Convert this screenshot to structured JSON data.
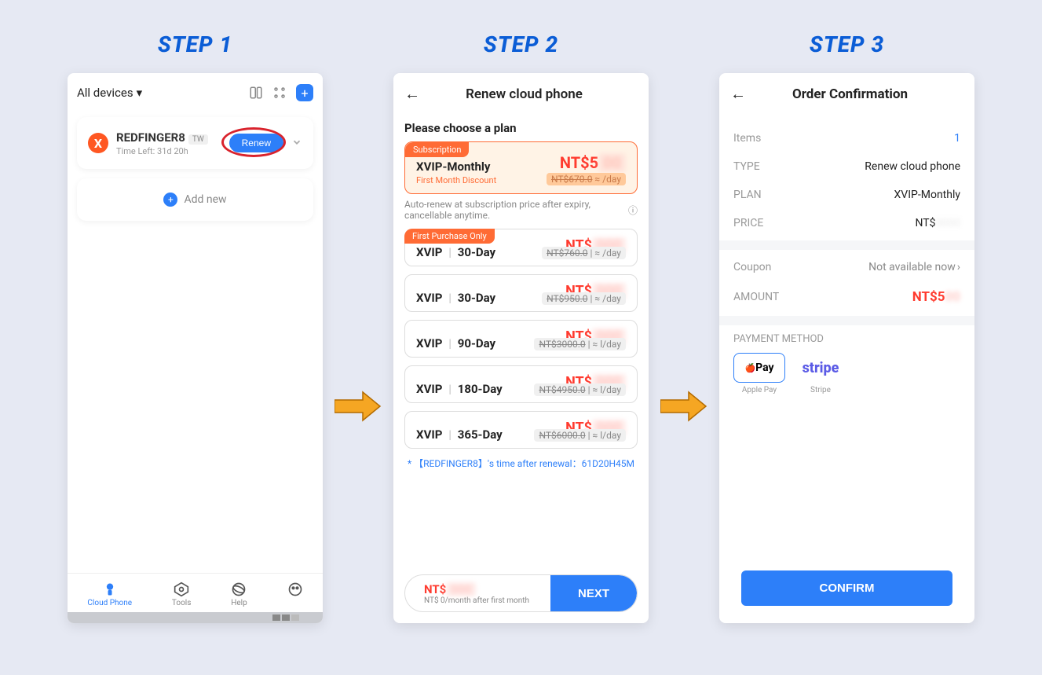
{
  "steps": [
    "STEP 1",
    "STEP 2",
    "STEP 3"
  ],
  "step1": {
    "dropdown": "All devices",
    "device": {
      "avatar": "X",
      "name": "REDFINGER8",
      "region": "TW",
      "timeleft": "Time Left: 31d 20h"
    },
    "renew_btn": "Renew",
    "addnew": "Add new",
    "tabs": [
      "Cloud Phone",
      "Tools",
      "Help",
      ""
    ]
  },
  "step2": {
    "title": "Renew cloud phone",
    "prompt": "Please choose a plan",
    "selected": {
      "badge": "Subscription",
      "name": "XVIP-Monthly",
      "sub": "First Month Discount",
      "price": "NT$5",
      "strike": "NT$670.0",
      "perday": "≈        /day"
    },
    "autorenew": "Auto-renew at subscription price after expiry, cancellable anytime.",
    "plans": [
      {
        "badge": "First Purchase Only",
        "tier": "XVIP",
        "duration": "30-Day",
        "price": "NT$",
        "strike": "NT$760.0",
        "perday": "| ≈      /day"
      },
      {
        "badge": "",
        "tier": "XVIP",
        "duration": "30-Day",
        "price": "NT$",
        "strike": "NT$950.0",
        "perday": "| ≈      /day"
      },
      {
        "badge": "",
        "tier": "XVIP",
        "duration": "90-Day",
        "price": "NT$",
        "strike": "NT$3000.0",
        "perday": "| ≈      l/day"
      },
      {
        "badge": "",
        "tier": "XVIP",
        "duration": "180-Day",
        "price": "NT$",
        "strike": "NT$4950.0",
        "perday": "| ≈      l/day"
      },
      {
        "badge": "",
        "tier": "XVIP",
        "duration": "365-Day",
        "price": "NT$",
        "strike": "NT$6000.0",
        "perday": "| ≈      l/day"
      }
    ],
    "note": "* 【REDFINGER8】's time after renewal：61D20H45M",
    "footer_price": "NT$",
    "footer_sub": "NT$      0/month after first month",
    "next": "NEXT"
  },
  "step3": {
    "title": "Order Confirmation",
    "rows": {
      "items_l": "Items",
      "items_v": "1",
      "type_l": "TYPE",
      "type_v": "Renew cloud phone",
      "plan_l": "PLAN",
      "plan_v": "XVIP-Monthly",
      "price_l": "PRICE",
      "price_v": "NT$",
      "coupon_l": "Coupon",
      "coupon_v": "Not available now",
      "amount_l": "AMOUNT",
      "amount_v": "NT$5"
    },
    "pm_label": "PAYMENT METHOD",
    "pm": [
      {
        "name": "Apple Pay",
        "label": "Pay"
      },
      {
        "name": "Stripe",
        "label": "stripe"
      }
    ],
    "confirm": "CONFIRM"
  }
}
